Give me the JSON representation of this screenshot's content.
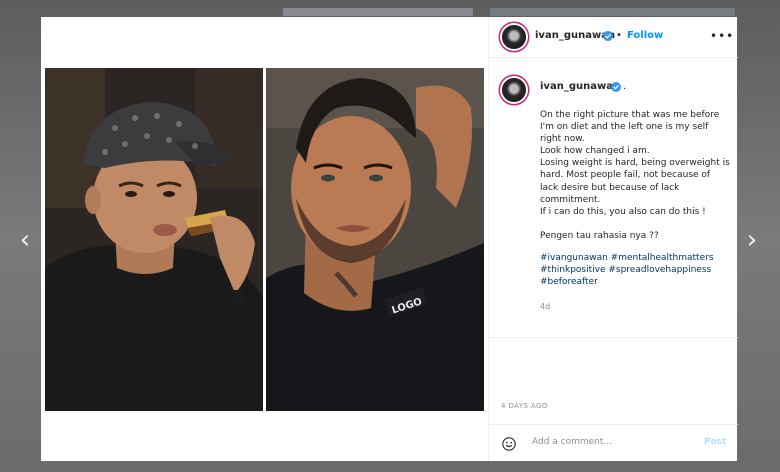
{
  "post": {
    "username": "ivan_gunawan",
    "follow_label": "Follow",
    "separator": "•",
    "more_label": "•••",
    "caption_author": "ivan_gunawan",
    "caption_author_suffix": ".",
    "caption_text": "On the right picture that was me before I'm on diet and the left one is my self right now.\nLook how changed i am.\nLosing weight is hard, being overweight is hard. Most people fail, not because of lack desire but because of lack commitment.\nIf i can do this, you also can do this !\n\nPengen tau rahasia nya ??",
    "hashtags": "#ivangunawan #mentalhealthmatters #thinkpositive #spreadlovehappiness #beforeafter",
    "caption_age": "4d",
    "date": "4 DAYS AGO",
    "comment_placeholder": "Add a comment...",
    "post_label": "Post"
  },
  "nav": {
    "prev_icon": "‹",
    "next_icon": "›"
  },
  "photos": {
    "right_shirt_logo": "LOGO"
  },
  "colors": {
    "link": "#0095f6",
    "hashtag": "#00376b",
    "post_disabled": "#b2dffc",
    "story_ring": "#c7277b"
  }
}
